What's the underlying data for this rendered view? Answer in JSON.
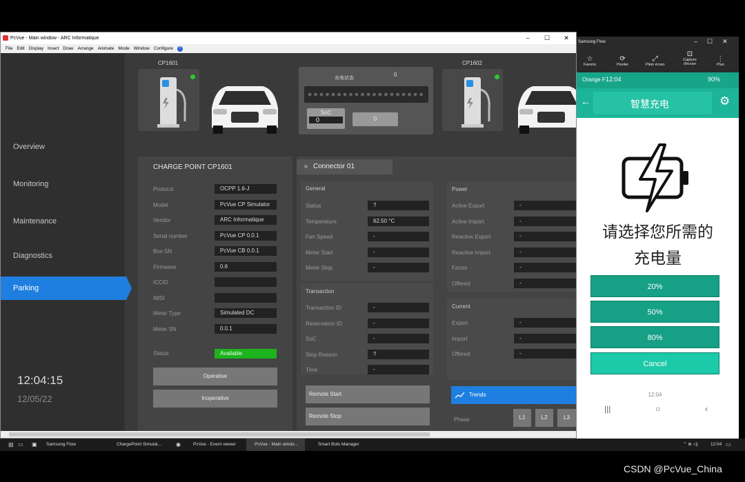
{
  "window": {
    "title": "PcVue - Main window - ARC Informatique",
    "min": "–",
    "max": "☐",
    "close": "✕"
  },
  "menu": [
    "File",
    "Edit",
    "Display",
    "Insert",
    "Draw",
    "Arrange",
    "Animate",
    "Mode",
    "Window",
    "Configure",
    "?"
  ],
  "nav": {
    "items": [
      "Overview",
      "Monitoring",
      "Maintenance",
      "Diagnostics",
      "Parking"
    ],
    "active": "Parking"
  },
  "clock": {
    "time": "12:04:15",
    "date": "12/05/22"
  },
  "station1": {
    "name": "CP1601"
  },
  "station2": {
    "name": "CP1602"
  },
  "charge_status": {
    "label": "充电状态",
    "value": "0",
    "soc_label": "SoC",
    "soc_value": "0",
    "value2": "0"
  },
  "chargepoint": {
    "title": "CHARGE POINT CP1601",
    "rows": [
      {
        "label": "Protocol",
        "value": "OCPP 1.6-J"
      },
      {
        "label": "Model",
        "value": "PcVue CP Simulator"
      },
      {
        "label": "Vendor",
        "value": "ARC Informatique"
      },
      {
        "label": "Serial number",
        "value": "PcVue CP 0.0.1"
      },
      {
        "label": "Box SN",
        "value": "PcVue CB 0.0.1"
      },
      {
        "label": "Firmware",
        "value": "0.6"
      },
      {
        "label": "ICCID",
        "value": ""
      },
      {
        "label": "IMSI",
        "value": ""
      },
      {
        "label": "Meter Type",
        "value": "Simulated DC"
      },
      {
        "label": "Meter SN",
        "value": "0.0.1"
      }
    ],
    "status_label": "Status",
    "status_value": "Available",
    "operative": "Operative",
    "inoperative": "Inoperative"
  },
  "connector": {
    "title": "Connector 01",
    "general_title": "General",
    "general": [
      {
        "label": "Status",
        "value": "?"
      },
      {
        "label": "Temperature",
        "value": "62.50 °C"
      },
      {
        "label": "Fan Speed",
        "value": "-"
      },
      {
        "label": "Meter Start",
        "value": "-"
      },
      {
        "label": "Meter Stop",
        "value": "-"
      }
    ],
    "transaction_title": "Transaction",
    "transaction": [
      {
        "label": "Transaction ID",
        "value": "-"
      },
      {
        "label": "Reservation ID",
        "value": "-"
      },
      {
        "label": "SoC",
        "value": "-"
      },
      {
        "label": "Stop Reason",
        "value": "?"
      },
      {
        "label": "Time",
        "value": "-"
      }
    ],
    "power_title": "Power",
    "power": [
      {
        "label": "Active Export",
        "value": "-"
      },
      {
        "label": "Active Import",
        "value": "-"
      },
      {
        "label": "Reactive Export",
        "value": "-"
      },
      {
        "label": "Reactive Import",
        "value": "-"
      },
      {
        "label": "Factor",
        "value": "-"
      },
      {
        "label": "Offered",
        "value": "-"
      }
    ],
    "current_title": "Current",
    "current": [
      {
        "label": "Export",
        "value": "-"
      },
      {
        "label": "Import",
        "value": "-"
      },
      {
        "label": "Offered",
        "value": "-"
      }
    ],
    "remote_start": "Remote Start",
    "remote_stop": "Remote Stop",
    "trends": "Trends",
    "phase_label": "Phase",
    "phases": [
      "L1",
      "L2",
      "L3"
    ]
  },
  "phone": {
    "app_title": "Samsung Flow",
    "toolbar": [
      "Favoris",
      "Pivoter",
      "Plein écran",
      "Capture d'écran",
      "Plus"
    ],
    "carrier": "Orange F",
    "time": "12:04",
    "battery": "90%",
    "header": "智慧充电",
    "prompt_line1": "请选择您所需的",
    "prompt_line2": "充电量",
    "options": [
      "20%",
      "50%",
      "80%"
    ],
    "cancel": "Cancel",
    "footer_time": "12:04"
  },
  "taskbar": {
    "items": [
      "Samsung Flow",
      "ChargePoint Simulat...",
      "PcVue - Event viewer",
      "PcVue - Main windo...",
      "Smart Bots Manager"
    ],
    "time": "12:04"
  },
  "watermark": "CSDN @PcVue_China",
  "colors": {
    "accent": "#1e7fe0",
    "available": "#1db31d",
    "teal": "#16a085"
  }
}
